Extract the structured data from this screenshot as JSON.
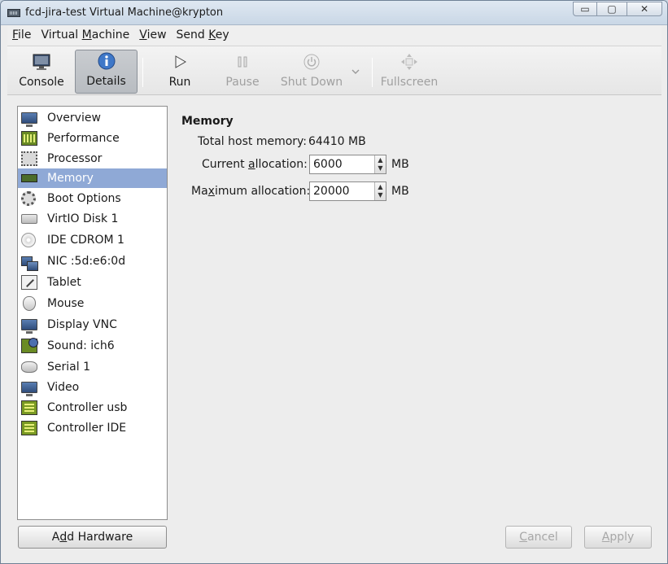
{
  "window": {
    "title": "fcd-jira-test Virtual Machine@krypton",
    "controls": {
      "minimize": "▭",
      "maximize": "▢",
      "close": "✕"
    }
  },
  "menubar": {
    "items": [
      {
        "pre": "",
        "mnemonic": "F",
        "post": "ile"
      },
      {
        "pre": "Virtual ",
        "mnemonic": "M",
        "post": "achine"
      },
      {
        "pre": "",
        "mnemonic": "V",
        "post": "iew"
      },
      {
        "pre": "Send ",
        "mnemonic": "K",
        "post": "ey"
      }
    ]
  },
  "toolbar": {
    "console": "Console",
    "details": "Details",
    "run": "Run",
    "pause": "Pause",
    "shutdown": "Shut Down",
    "fullscreen": "Fullscreen"
  },
  "sidebar": {
    "items": [
      {
        "label": "Overview",
        "icon": "monitor-icon"
      },
      {
        "label": "Performance",
        "icon": "performance-icon"
      },
      {
        "label": "Processor",
        "icon": "chip-icon"
      },
      {
        "label": "Memory",
        "icon": "memory-icon"
      },
      {
        "label": "Boot Options",
        "icon": "gear-icon"
      },
      {
        "label": "VirtIO Disk 1",
        "icon": "disk-icon"
      },
      {
        "label": "IDE CDROM 1",
        "icon": "cdrom-icon"
      },
      {
        "label": "NIC :5d:e6:0d",
        "icon": "network-icon"
      },
      {
        "label": "Tablet",
        "icon": "tablet-icon"
      },
      {
        "label": "Mouse",
        "icon": "mouse-icon"
      },
      {
        "label": "Display VNC",
        "icon": "display-icon"
      },
      {
        "label": "Sound: ich6",
        "icon": "sound-icon"
      },
      {
        "label": "Serial 1",
        "icon": "serial-icon"
      },
      {
        "label": "Video",
        "icon": "video-icon"
      },
      {
        "label": "Controller usb",
        "icon": "controller-icon"
      },
      {
        "label": "Controller IDE",
        "icon": "controller-icon"
      }
    ],
    "selected": "Memory"
  },
  "details": {
    "section_title": "Memory",
    "total_host_memory_label": "Total host memory:",
    "total_host_memory_value": "64410 MB",
    "current_allocation_label_pre": "Current ",
    "current_allocation_label_mnemonic": "a",
    "current_allocation_label_post": "llocation:",
    "current_allocation_value": "6000",
    "max_allocation_label_pre": "Ma",
    "max_allocation_label_mnemonic": "x",
    "max_allocation_label_post": "imum allocation:",
    "max_allocation_value": "20000",
    "unit": "MB"
  },
  "buttons": {
    "add_hardware_pre": "A",
    "add_hardware_mnemonic": "d",
    "add_hardware_post": "d Hardware",
    "cancel_mnemonic": "C",
    "cancel_post": "ancel",
    "apply_mnemonic": "A",
    "apply_post": "pply"
  }
}
